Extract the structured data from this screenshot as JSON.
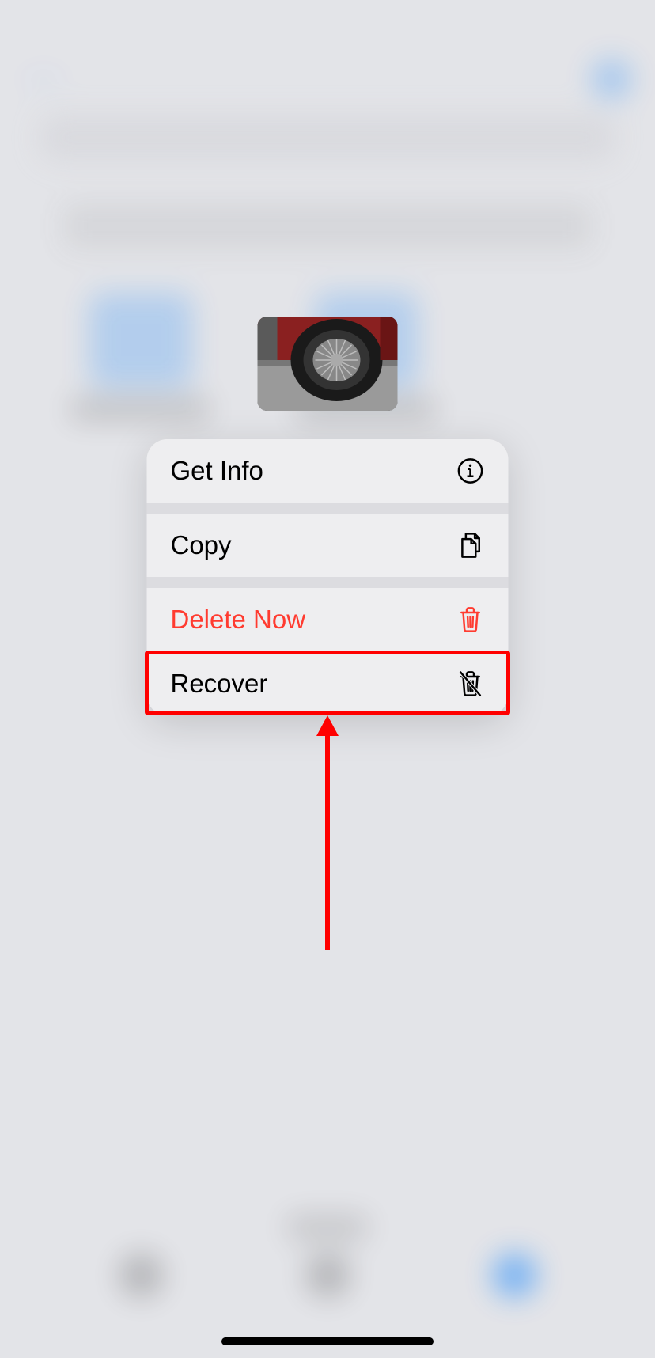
{
  "menu": {
    "get_info": "Get Info",
    "copy": "Copy",
    "delete_now": "Delete Now",
    "recover": "Recover"
  },
  "icons": {
    "info": "info-icon",
    "copy": "copy-icon",
    "trash": "trash-icon",
    "recover": "recover-trash-icon"
  }
}
